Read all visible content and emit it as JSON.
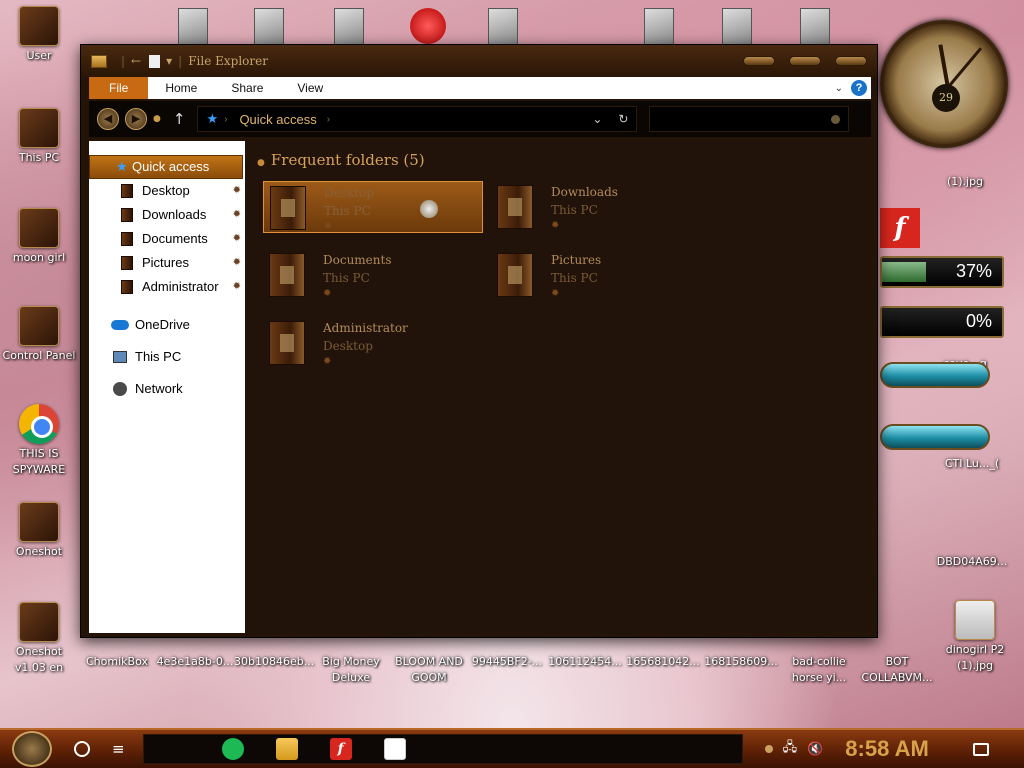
{
  "desktop": {
    "icons_left": [
      {
        "label": "User"
      },
      {
        "label": "This PC"
      },
      {
        "label": "moon girl"
      },
      {
        "label": "Control Panel"
      },
      {
        "label": "THIS IS SPYWARE"
      },
      {
        "label": "Oneshot"
      },
      {
        "label": "Oneshot v1.03 en"
      }
    ],
    "icons_bottom": [
      {
        "label": "ChomikBox"
      },
      {
        "label": "4e3e1a8b-0..."
      },
      {
        "label": "30b10846eb..."
      },
      {
        "label": "Big Money Deluxe"
      },
      {
        "label": "BLOOM AND GOOM"
      },
      {
        "label": "99445BF2-..."
      },
      {
        "label": "106112454..."
      },
      {
        "label": "165681042..."
      },
      {
        "label": "168158609..."
      },
      {
        "label": "bad-collie horse yi..."
      },
      {
        "label": "BOT COLLABVM..."
      },
      {
        "label": "dinogirl P2 (1).jpg"
      }
    ],
    "icons_right": [
      {
        "label": "(1).jpg"
      },
      {
        "label": "cove...g"
      },
      {
        "label": "CTI Lu..._("
      },
      {
        "label": "DBD04A69..."
      }
    ],
    "widgets": {
      "clock_date": "29",
      "cpu_gauge": {
        "value": "37%",
        "level": 0.37
      },
      "ram_gauge": {
        "value": "0%",
        "level": 0.0
      }
    }
  },
  "window": {
    "title": "File Explorer",
    "ribbon_tabs": [
      "File",
      "Home",
      "Share",
      "View"
    ],
    "address": {
      "location": "Quick access"
    },
    "nav_pane": {
      "quick_access": "Quick access",
      "pinned": [
        "Desktop",
        "Downloads",
        "Documents",
        "Pictures",
        "Administrator"
      ],
      "groups": [
        "OneDrive",
        "This PC",
        "Network"
      ]
    },
    "content": {
      "section_title": "Frequent folders (5)",
      "folders": [
        {
          "name": "Desktop",
          "location": "This PC"
        },
        {
          "name": "Downloads",
          "location": "This PC"
        },
        {
          "name": "Documents",
          "location": "This PC"
        },
        {
          "name": "Pictures",
          "location": "This PC"
        },
        {
          "name": "Administrator",
          "location": "Desktop"
        }
      ]
    }
  },
  "taskbar": {
    "pinned_apps": [
      "spotify-icon",
      "file-explorer-icon",
      "flash-player-icon",
      "photos-icon"
    ],
    "time": "8:58 AM"
  },
  "colors": {
    "accent": "#c86a13",
    "window_bg": "#21130a",
    "address_text": "#e2b56a",
    "clock_text": "#d8a24a"
  }
}
